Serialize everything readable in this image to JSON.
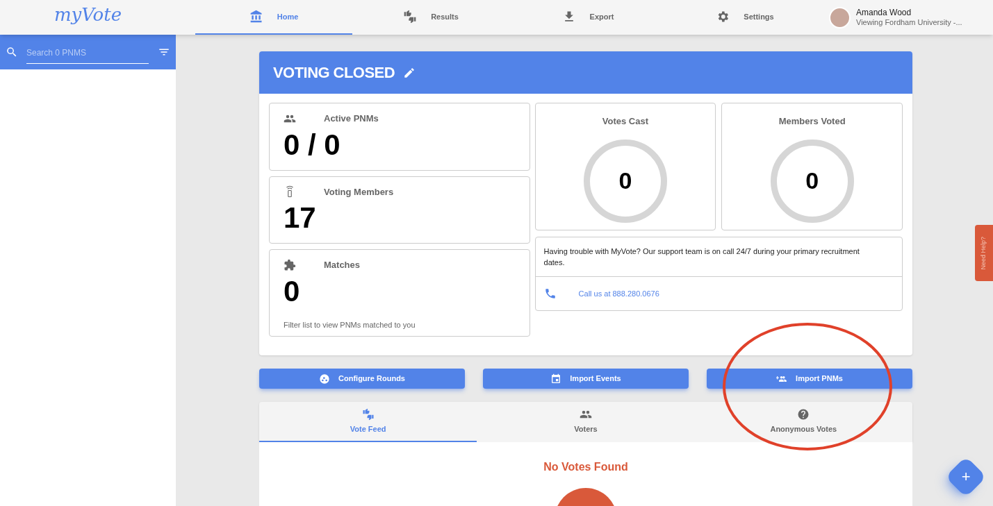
{
  "logo": "myVote",
  "nav": [
    {
      "label": "Home",
      "kind": "bank",
      "selected": true
    },
    {
      "label": "Results",
      "kind": "thumbs",
      "selected": false
    },
    {
      "label": "Export",
      "kind": "download",
      "selected": false
    },
    {
      "label": "Settings",
      "kind": "gear",
      "selected": false
    }
  ],
  "user": {
    "name": "Amanda Wood",
    "subtitle": "Viewing Fordham University -..."
  },
  "sidebar": {
    "search": {
      "placeholder": "Search 0 PNMS"
    }
  },
  "panel": {
    "title": "VOTING CLOSED",
    "stats": [
      {
        "label": "Active PNMs",
        "kind": "people",
        "value": "0 / 0"
      },
      {
        "label": "Voting Members",
        "kind": "remote",
        "value": "17"
      },
      {
        "label": "Matches",
        "kind": "puzzle",
        "value": "0",
        "note": "Filter list to view PNMs matched to you"
      }
    ],
    "gauges": [
      {
        "label": "Votes Cast",
        "value": "0"
      },
      {
        "label": "Members Voted",
        "value": "0"
      }
    ],
    "support": {
      "text": "Having trouble with MyVote? Our support team is on call 24/7 during your primary recruitment dates.",
      "link": "Call us at 888.280.0676"
    }
  },
  "actions": [
    {
      "label": "Configure Rounds",
      "kind": "rounds"
    },
    {
      "label": "Import Events",
      "kind": "calendar"
    },
    {
      "label": "Import PNMs",
      "kind": "addpeople"
    }
  ],
  "tabs": [
    {
      "label": "Vote Feed",
      "kind": "thumbs",
      "selected": true
    },
    {
      "label": "Voters",
      "kind": "people",
      "selected": false
    },
    {
      "label": "Anonymous Votes",
      "kind": "question",
      "selected": false
    }
  ],
  "feed": {
    "empty_message": "No Votes Found"
  },
  "help_tab": "Need Help?",
  "fab": "+"
}
